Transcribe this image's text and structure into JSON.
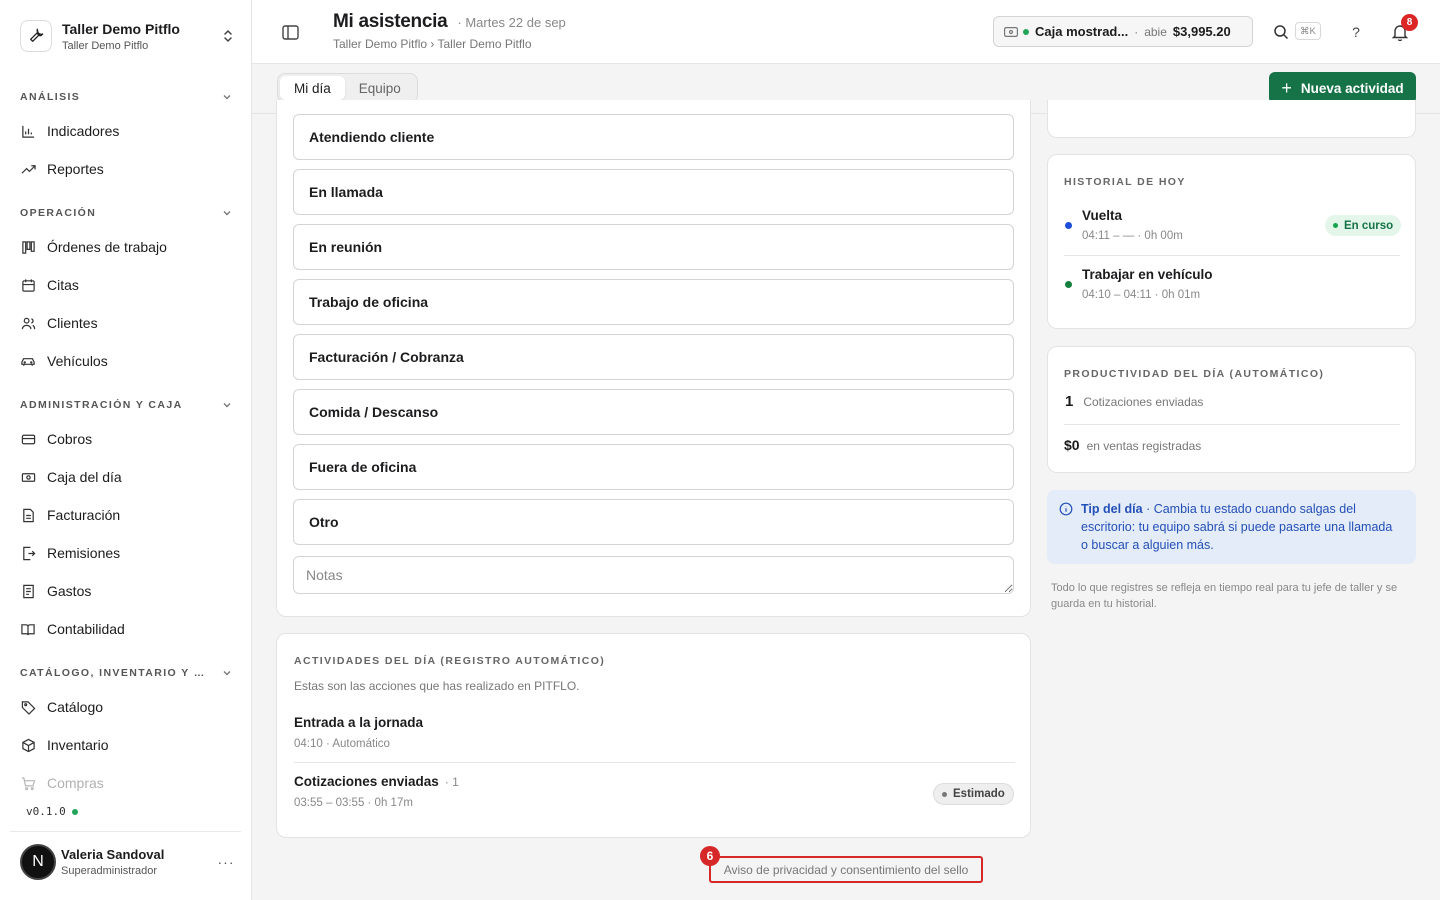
{
  "workspace": {
    "name": "Taller Demo Pitflo",
    "subtitle": "Taller Demo Pitflo"
  },
  "sidebar": {
    "sections": [
      {
        "label": "ANÁLISIS",
        "items": [
          "Indicadores",
          "Reportes"
        ]
      },
      {
        "label": "OPERACIÓN",
        "items": [
          "Órdenes de trabajo",
          "Citas",
          "Clientes",
          "Vehículos"
        ]
      },
      {
        "label": "ADMINISTRACIÓN Y CAJA",
        "items": [
          "Cobros",
          "Caja del día",
          "Facturación",
          "Remisiones",
          "Gastos",
          "Contabilidad"
        ]
      },
      {
        "label": "CATÁLOGO, INVENTARIO Y CO...",
        "items": [
          "Catálogo",
          "Inventario",
          "Compras"
        ]
      }
    ],
    "version": "v0.1.0",
    "user": {
      "initial": "N",
      "name": "Valeria Sandoval",
      "role": "Superadministrador",
      "menu": "···"
    }
  },
  "header": {
    "title": "Mi asistencia",
    "date": "· Martes 22 de sep",
    "breadcrumb": "Taller Demo Pitflo › Taller Demo Pitflo",
    "cash": {
      "name": "Caja mostrad...",
      "separator": "·",
      "status": "abie",
      "amount": "$3,995.20"
    },
    "shortcut": "⌘K",
    "help": "?",
    "notifications": "8"
  },
  "subbar": {
    "tabs": [
      "Mi día",
      "Equipo"
    ],
    "new_activity": "Nueva actividad",
    "new_plus": "+"
  },
  "status_options": [
    "Atendiendo cliente",
    "En llamada",
    "En reunión",
    "Trabajo de oficina",
    "Facturación / Cobranza",
    "Comida / Descanso",
    "Fuera de oficina",
    "Otro"
  ],
  "notes_placeholder": "Notas",
  "activities": {
    "title": "ACTIVIDADES DEL DÍA (REGISTRO AUTOMÁTICO)",
    "intro": "Estas son las acciones que has realizado en PITFLO.",
    "items": [
      {
        "title": "Entrada a la jornada",
        "count": "",
        "meta": "04:10 · Automático",
        "tag": ""
      },
      {
        "title": "Cotizaciones enviadas",
        "count": "· 1",
        "meta": "03:55 – 03:55 · 0h 17m",
        "tag": "Estimado"
      }
    ]
  },
  "history": {
    "title": "HISTORIAL DE HOY",
    "items": [
      {
        "title": "Vuelta",
        "meta": "04:11 – — · 0h 00m",
        "tag": "En curso",
        "dot": "#1d4ed8"
      },
      {
        "title": "Trabajar en vehículo",
        "meta": "04:10 – 04:11 · 0h 01m",
        "tag": "",
        "dot": "#15803d"
      }
    ]
  },
  "productivity": {
    "title": "PRODUCTIVIDAD DEL DÍA (AUTOMÁTICO)",
    "quotes_value": "1",
    "quotes_label": "Cotizaciones enviadas",
    "sales_value": "$0",
    "sales_label": "en ventas registradas"
  },
  "tip": {
    "label": "Tip del día",
    "text": " · Cambia tu estado cuando salgas del escritorio: tu equipo sabrá si puede pasarte una llamada o buscar a alguien más."
  },
  "footnote": "Todo lo que registres se refleja en tiempo real para tu jefe de taller y se guarda en tu historial.",
  "privacy": {
    "label": "Aviso de privacidad y consentimiento del sello",
    "badge": "6"
  },
  "colors": {
    "accent": "#157347",
    "danger": "#dc2626",
    "tip_bg": "#e4ebf9",
    "tip_text": "#2350b8"
  }
}
